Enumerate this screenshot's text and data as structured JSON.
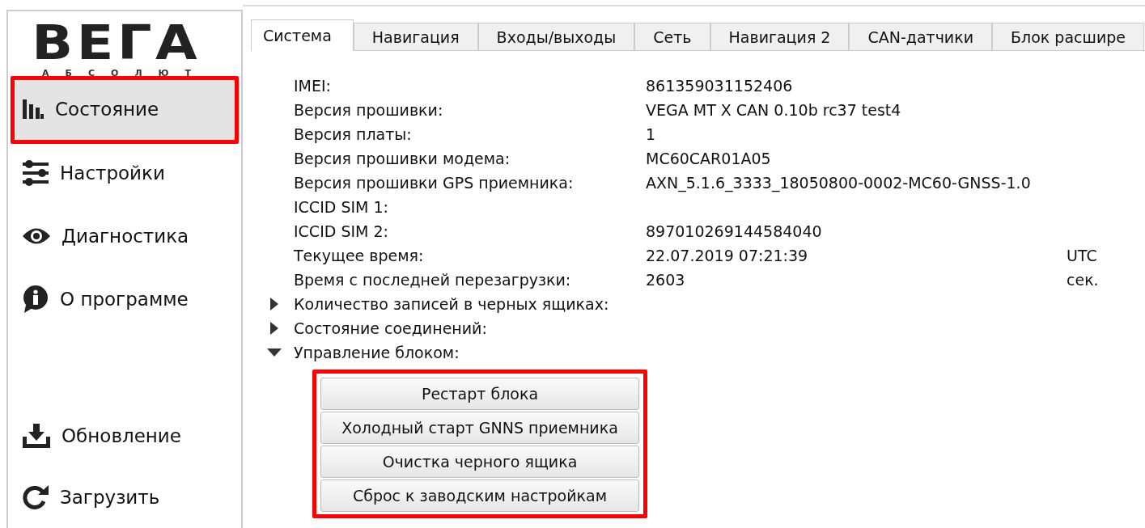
{
  "logo": {
    "wordmark": "ВЕГА",
    "tagline": "АБСОЛЮТ"
  },
  "sidebar": {
    "items": [
      {
        "label": "Состояние",
        "selected": true,
        "highlighted": true
      },
      {
        "label": "Настройки",
        "selected": false,
        "highlighted": false
      },
      {
        "label": "Диагностика",
        "selected": false,
        "highlighted": false
      },
      {
        "label": "О программе",
        "selected": false,
        "highlighted": false
      }
    ],
    "bottom_items": [
      {
        "label": "Обновление",
        "selected": false
      },
      {
        "label": "Загрузить",
        "selected": false
      }
    ]
  },
  "tabs": [
    {
      "label": "Система",
      "selected": true
    },
    {
      "label": "Навигация",
      "selected": false
    },
    {
      "label": "Входы/выходы",
      "selected": false
    },
    {
      "label": "Сеть",
      "selected": false
    },
    {
      "label": "Навигация 2",
      "selected": false
    },
    {
      "label": "CAN-датчики",
      "selected": false
    },
    {
      "label": "Блок расшире",
      "selected": false
    }
  ],
  "info_rows": [
    {
      "label": "IMEI:",
      "value": "861359031152406"
    },
    {
      "label": "Версия прошивки:",
      "value": "VEGA MT X CAN 0.10b rc37 test4"
    },
    {
      "label": "Версия платы:",
      "value": "1"
    },
    {
      "label": "Версия прошивки модема:",
      "value": "MC60CAR01A05"
    },
    {
      "label": "Версия прошивки GPS приемника:",
      "value": "AXN_5.1.6_3333_18050800-0002-MC60-GNSS-1.0"
    },
    {
      "label": "ICCID SIM 1:"
    },
    {
      "label": "ICCID SIM 2:",
      "value": "897010269144584040"
    },
    {
      "label": "Текущее время:",
      "value": "22.07.2019 07:21:39",
      "unit": "UTC"
    },
    {
      "label": "Время с последней перезагрузки:",
      "value": "2603",
      "unit": "сек."
    }
  ],
  "tree": [
    {
      "label": "Количество записей в черных ящиках:",
      "expanded": false
    },
    {
      "label": "Состояние соединений:",
      "expanded": false
    },
    {
      "label": "Управление блоком:",
      "expanded": true,
      "highlighted": true,
      "buttons": [
        "Рестарт блока",
        "Холодный старт GNNS приемника",
        "Очистка черного ящика",
        "Сброс к заводским настройкам"
      ]
    }
  ]
}
